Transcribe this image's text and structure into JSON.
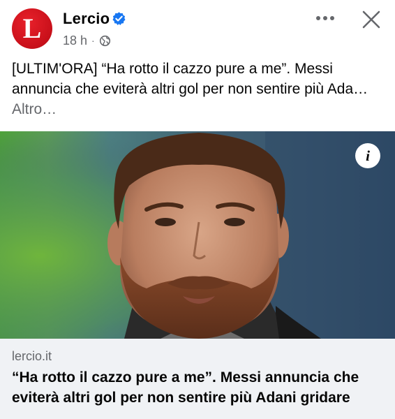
{
  "post": {
    "page_name": "Lercio",
    "avatar_letter": "L",
    "timestamp": "18 h",
    "meta_separator": "·",
    "verified": true,
    "audience_icon": "globe-icon",
    "caption_text": "[ULTIM'ORA] “Ha rotto il cazzo pure a me”. Messi annuncia che eviterà altri gol per non sentire più Ada…",
    "see_more_label": "Altro…",
    "link_preview": {
      "domain": "lercio.it",
      "title": "“Ha rotto il cazzo pure a me”. Messi annuncia che eviterà altri gol per non sentire più Adani gridare"
    }
  },
  "icons": {
    "verified": "verified-badge-icon",
    "more": "more-options-icon",
    "close": "close-icon",
    "info": "info-icon"
  },
  "colors": {
    "brand_red": "#c8101a",
    "verified_blue": "#1877f2",
    "secondary_text": "#65676b",
    "link_box_bg": "#f0f2f5"
  }
}
